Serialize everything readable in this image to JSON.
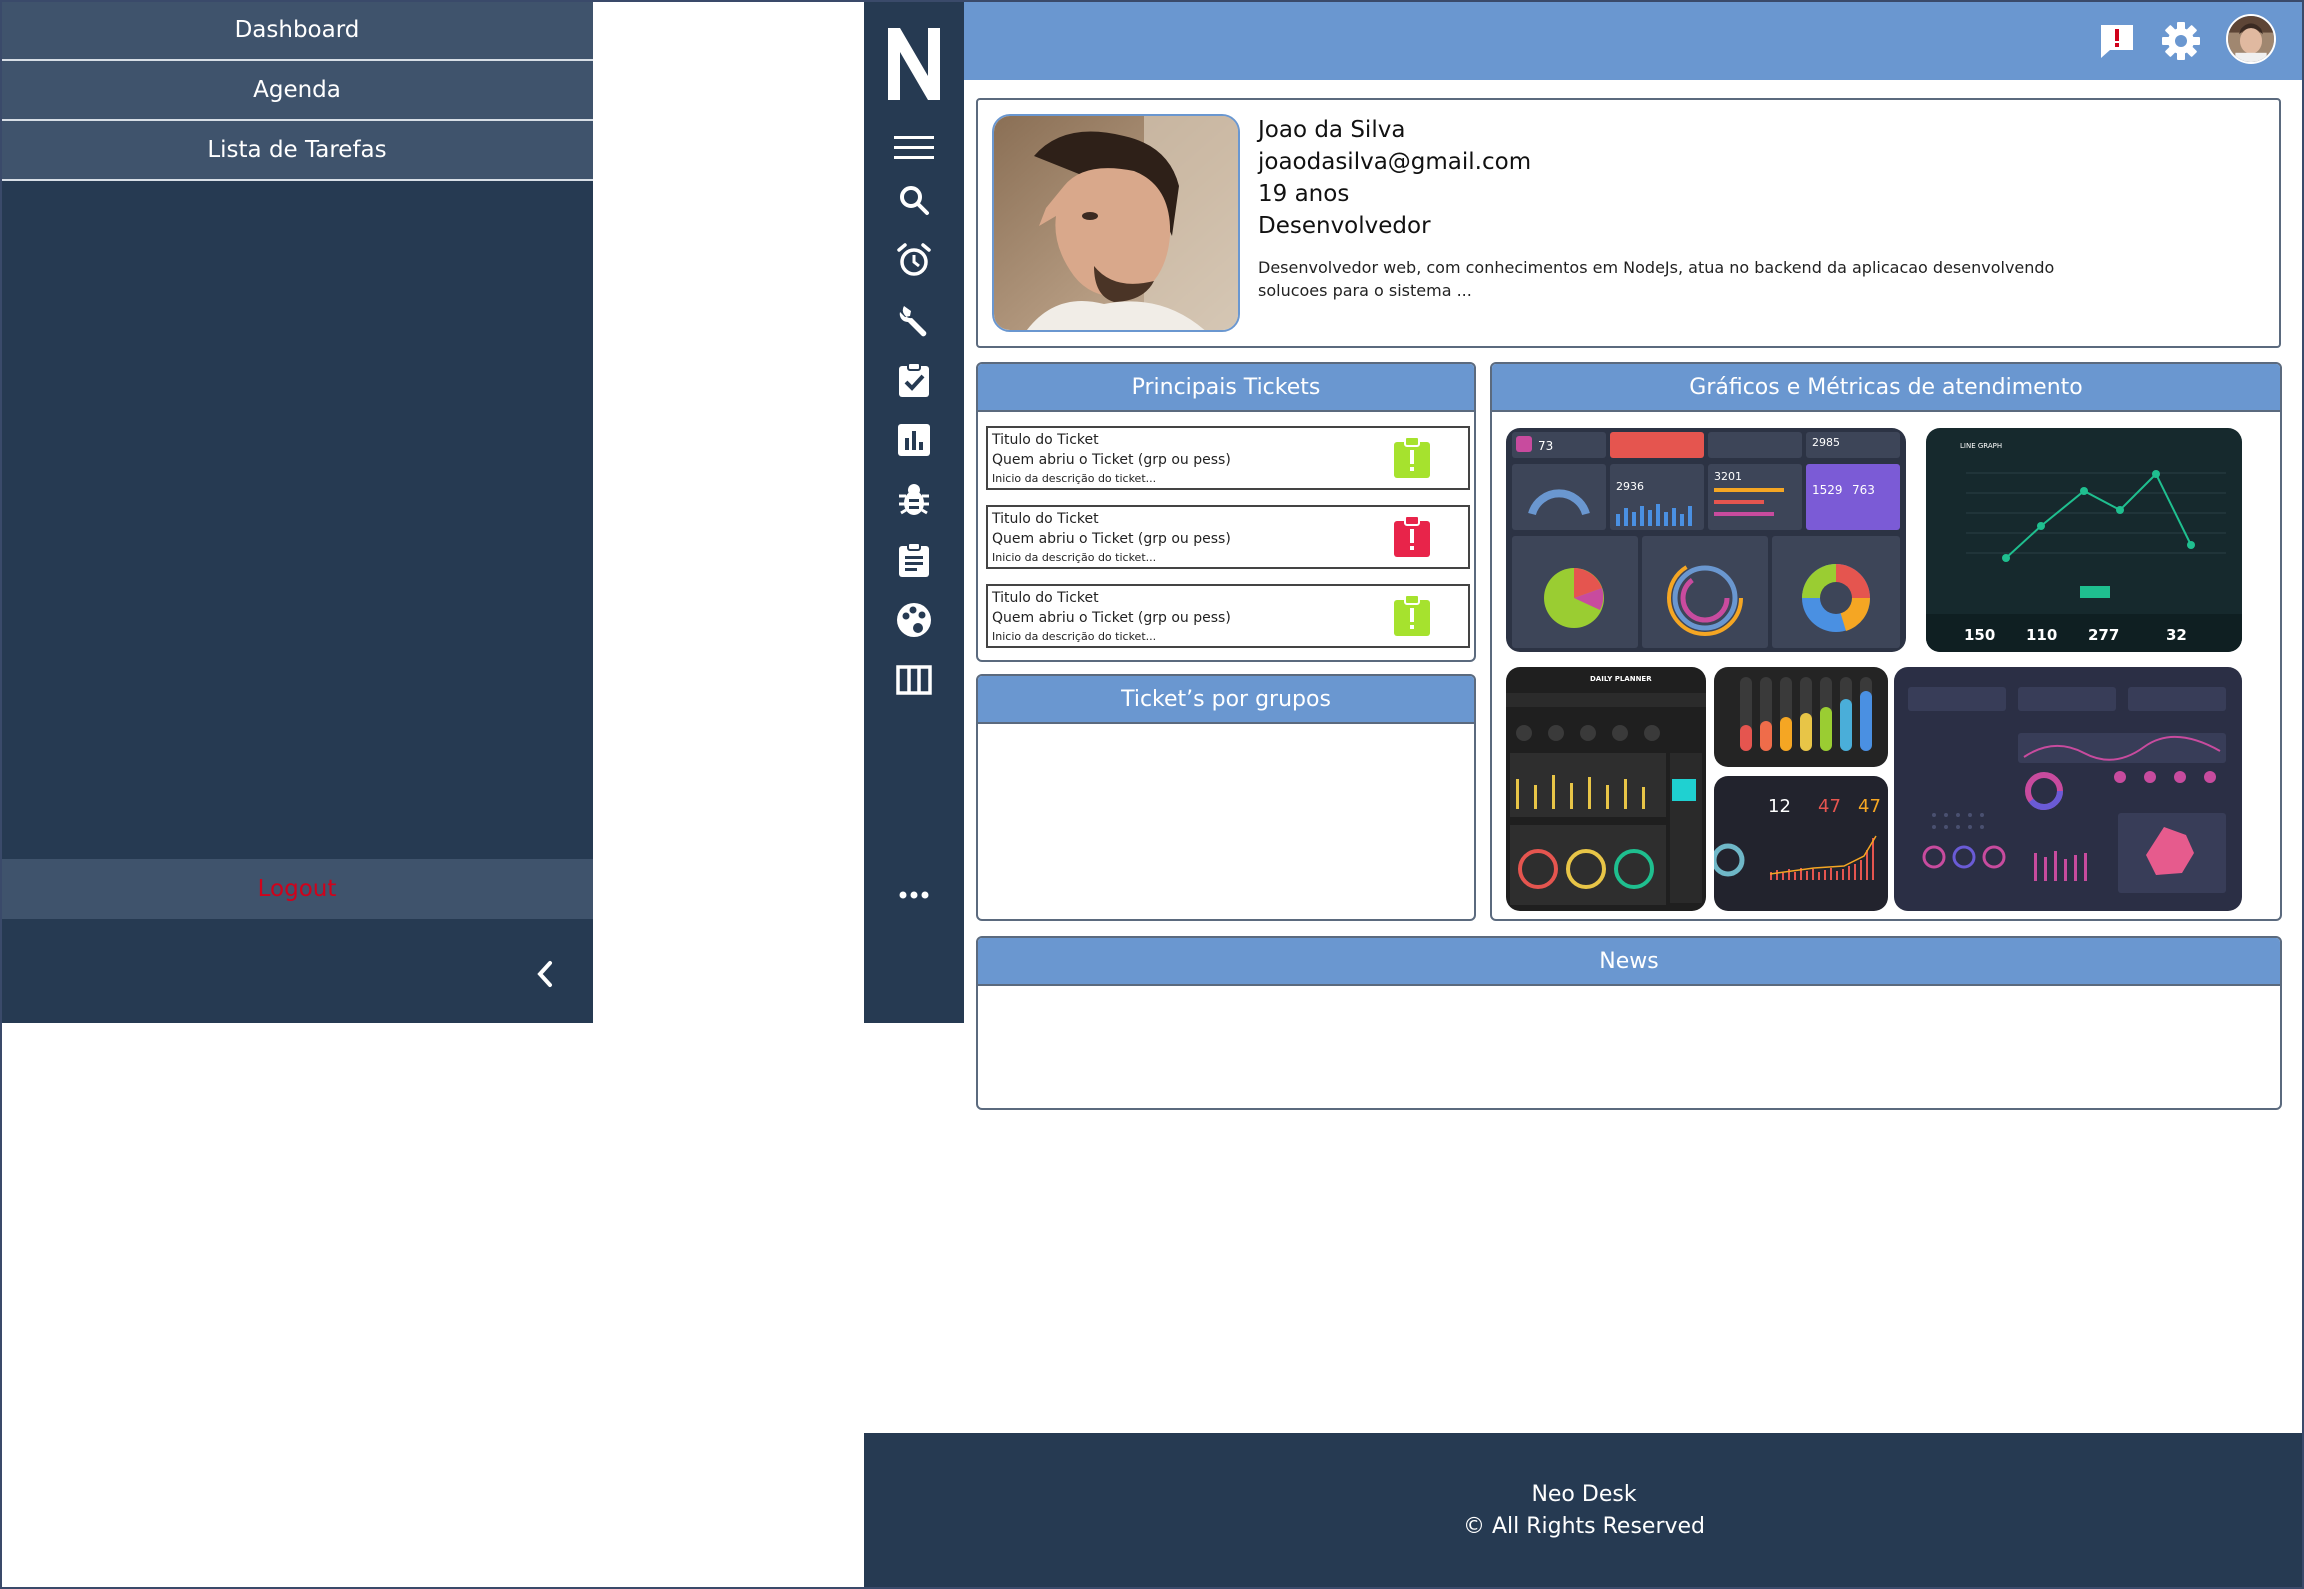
{
  "drawer": {
    "items": [
      {
        "label": "Dashboard"
      },
      {
        "label": "Agenda"
      },
      {
        "label": "Lista de Tarefas"
      }
    ],
    "logout_label": "Logout",
    "collapse_icon": "chevron-left-icon"
  },
  "rail": {
    "logo_letter": "N",
    "icons": [
      "menu-icon",
      "search-icon",
      "alarm-icon",
      "wrench-icon",
      "task-check-icon",
      "bar-chart-icon",
      "bug-icon",
      "clipboard-icon",
      "palette-icon",
      "columns-icon",
      "more-icon"
    ]
  },
  "header": {
    "icons": [
      "feedback-alert-icon",
      "gear-icon",
      "avatar"
    ]
  },
  "profile": {
    "name": "Joao da Silva",
    "email": "joaodasilva@gmail.com",
    "age": "19 anos",
    "role": "Desenvolvedor",
    "description": "Desenvolvedor web, com conhecimentos em NodeJs, atua no backend da aplicacao desenvolvendo solucoes para o sistema ..."
  },
  "tickets_panel": {
    "title": "Principais Tickets",
    "tickets": [
      {
        "title": "Titulo do Ticket",
        "opened_by": "Quem abriu o Ticket (grp ou pess)",
        "desc": "Inicio da descrição do ticket...",
        "status_color": "#a6e22e"
      },
      {
        "title": "Titulo do Ticket",
        "opened_by": "Quem abriu o Ticket (grp ou pess)",
        "desc": "Inicio da descrição do ticket...",
        "status_color": "#e8244a"
      },
      {
        "title": "Titulo do Ticket",
        "opened_by": "Quem abriu o Ticket (grp ou pess)",
        "desc": "Inicio da descrição do ticket...",
        "status_color": "#a6e22e"
      }
    ]
  },
  "groups_panel": {
    "title": "Ticket’s por grupos"
  },
  "metrics_panel": {
    "title": "Gráficos e Métricas de atendimento",
    "line_graph_stats": [
      "150",
      "110",
      "277",
      "32"
    ],
    "dash_stats": [
      "73",
      "2985",
      "2936",
      "3201",
      "1529",
      "763"
    ],
    "planner_title": "DAILY PLANNER",
    "small_stats": [
      "12",
      "47",
      "47"
    ]
  },
  "news_panel": {
    "title": "News"
  },
  "footer": {
    "line1": "Neo Desk",
    "line2": "© All Rights Reserved"
  },
  "colors": {
    "sidebar": "#263a52",
    "sidebar_item": "#3f536c",
    "accent_blue": "#6a97d0",
    "logout_red": "#d0021b",
    "status_green": "#a6e22e",
    "status_red": "#e8244a"
  }
}
